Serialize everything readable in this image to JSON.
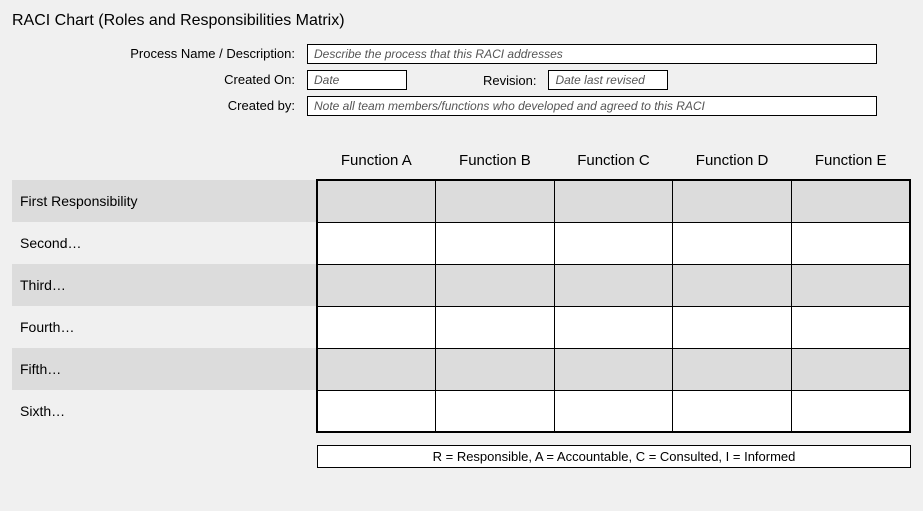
{
  "title": "RACI Chart (Roles and Responsibilities Matrix)",
  "form": {
    "process_label": "Process Name / Description:",
    "process_placeholder": "Describe the process that this RACI addresses",
    "created_on_label": "Created On:",
    "created_on_placeholder": "Date",
    "revision_label": "Revision:",
    "revision_placeholder": "Date last revised",
    "created_by_label": "Created by:",
    "created_by_placeholder": "Note all team members/functions who developed and agreed to this RACI"
  },
  "chart_data": {
    "type": "table",
    "columns": [
      "Function A",
      "Function B",
      "Function C",
      "Function D",
      "Function E"
    ],
    "rows": [
      {
        "label": "First Responsibility",
        "values": [
          "",
          "",
          "",
          "",
          ""
        ]
      },
      {
        "label": "Second…",
        "values": [
          "",
          "",
          "",
          "",
          ""
        ]
      },
      {
        "label": "Third…",
        "values": [
          "",
          "",
          "",
          "",
          ""
        ]
      },
      {
        "label": "Fourth…",
        "values": [
          "",
          "",
          "",
          "",
          ""
        ]
      },
      {
        "label": "Fifth…",
        "values": [
          "",
          "",
          "",
          "",
          ""
        ]
      },
      {
        "label": "Sixth…",
        "values": [
          "",
          "",
          "",
          "",
          ""
        ]
      }
    ]
  },
  "legend": "R = Responsible, A = Accountable, C = Consulted, I = Informed"
}
